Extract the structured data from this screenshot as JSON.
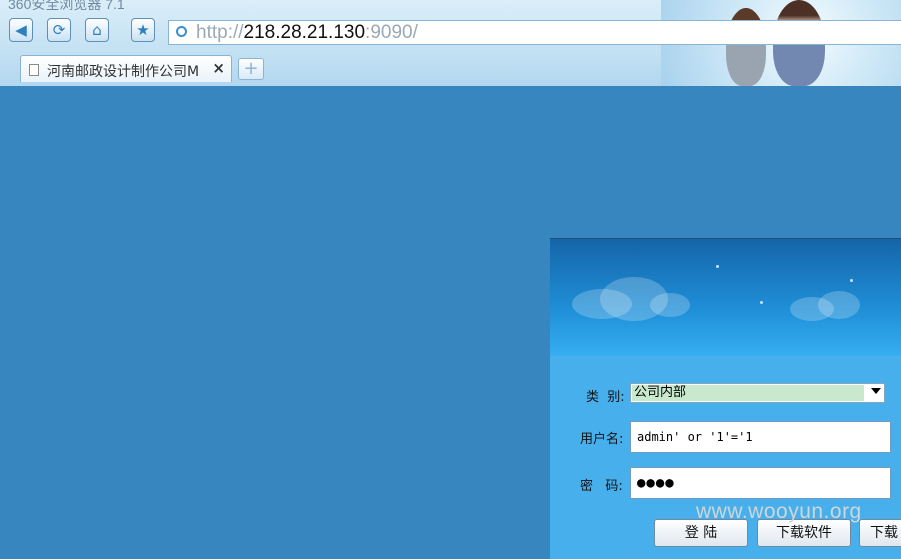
{
  "browser": {
    "title": "360安全浏览器 7.1",
    "address": {
      "scheme": "http://",
      "host": "218.28.21.130",
      "port": ":9090/"
    },
    "tab": {
      "label": "河南邮政设计制作公司M",
      "close_glyph": "×"
    },
    "new_tab_glyph": "+"
  },
  "login": {
    "category_label": "类  别:",
    "category_value": "公司内部",
    "username_label": "用户名:",
    "username_value": "admin' or '1'='1",
    "password_label": "密   码:",
    "password_value": "●●●●",
    "login_button": "登  陆",
    "download_software_button": "下载软件",
    "download_partial_button": "下载"
  },
  "watermark": "www.wooyun.org",
  "colors": {
    "page_bg": "#3786c0",
    "panel_bg": "#47b0ec",
    "select_highlight": "#c9e9cf"
  }
}
